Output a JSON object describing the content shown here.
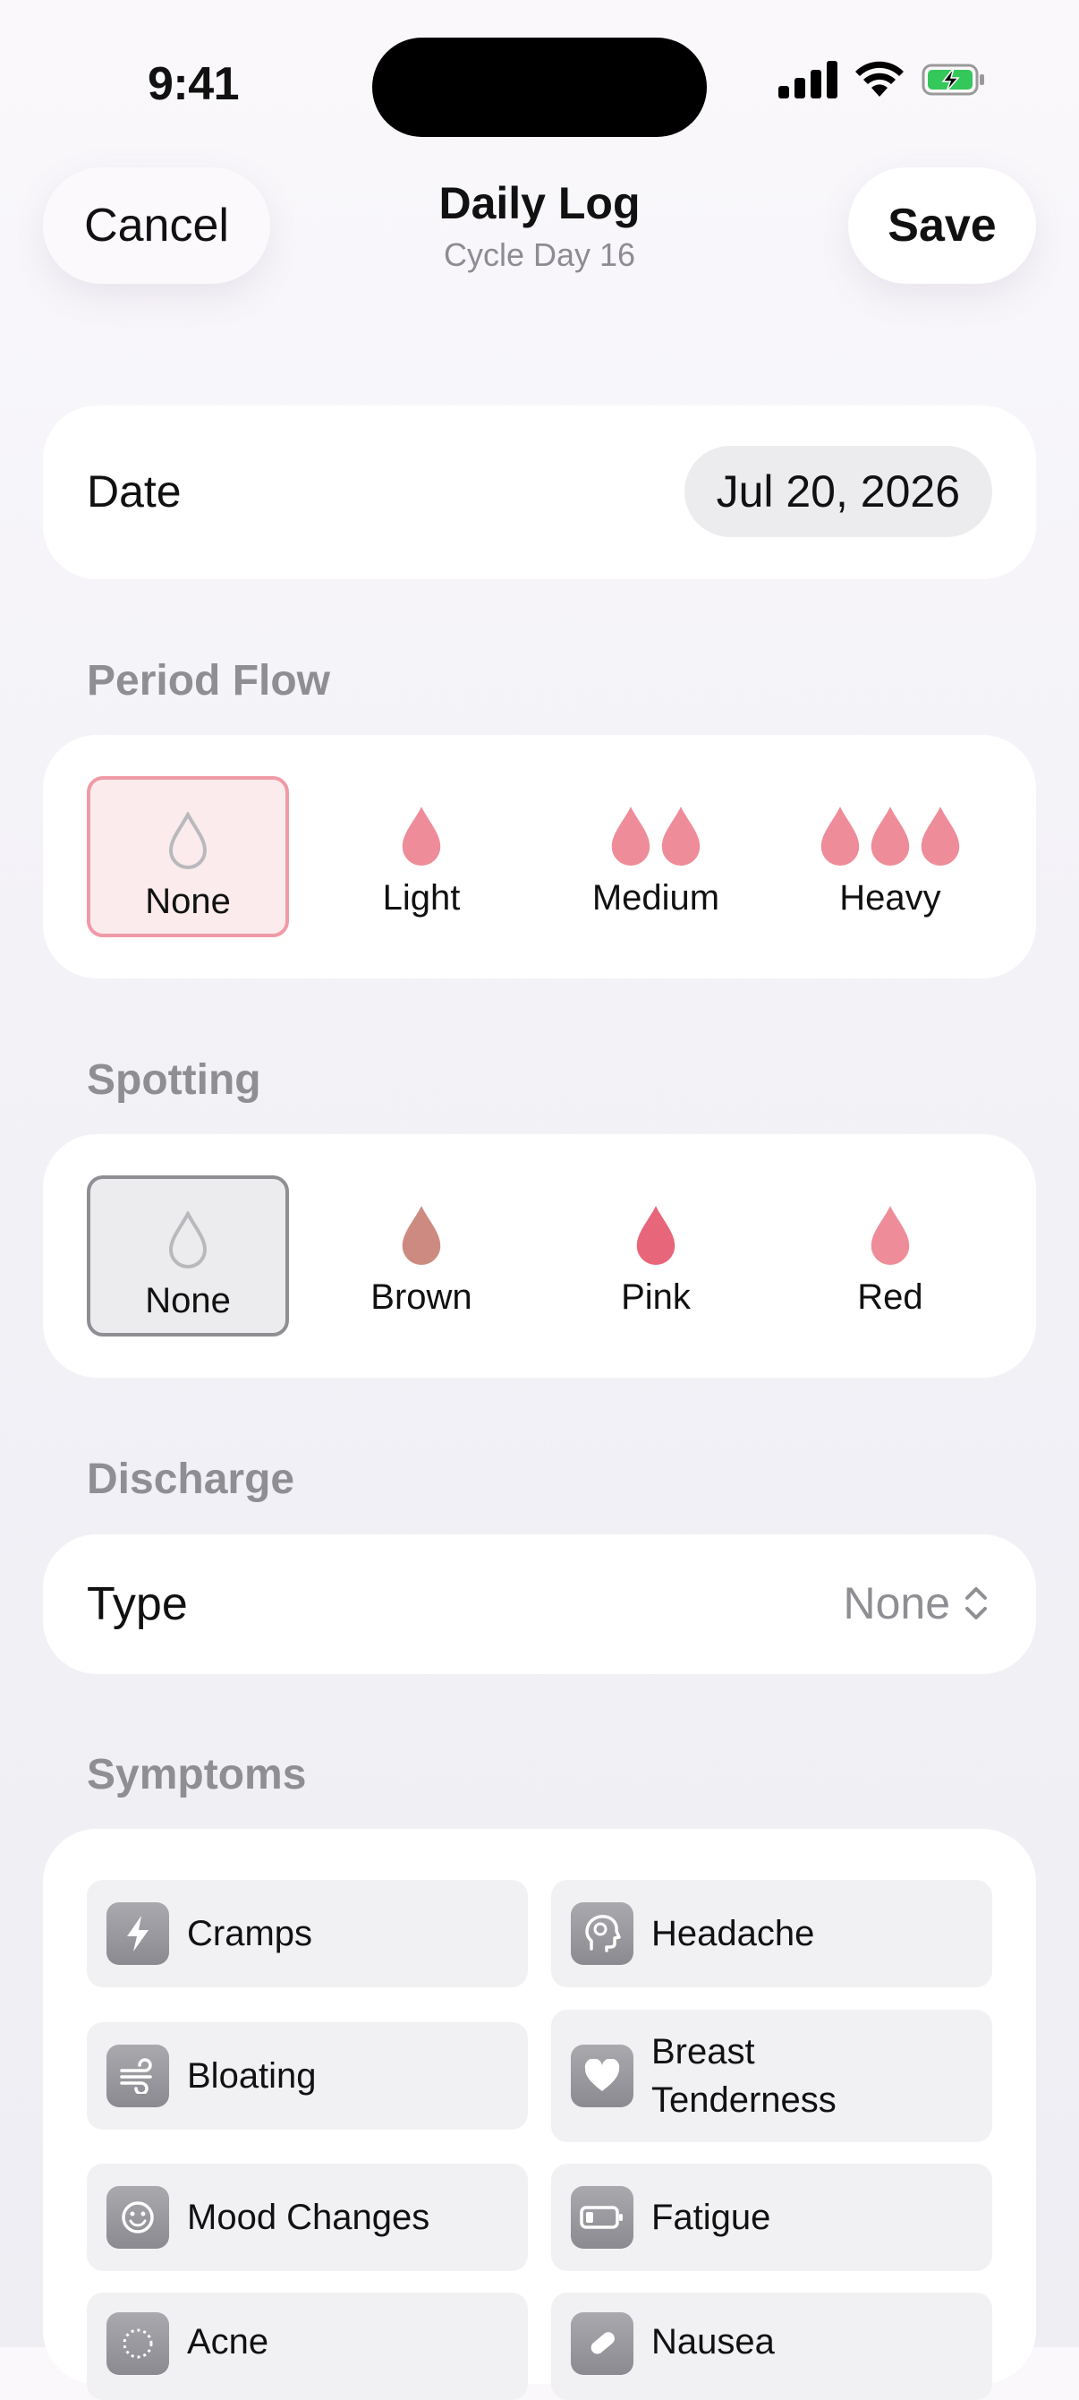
{
  "status_bar": {
    "time": "9:41"
  },
  "header": {
    "cancel_label": "Cancel",
    "title": "Daily Log",
    "subtitle": "Cycle Day 16",
    "save_label": "Save"
  },
  "date_row": {
    "label": "Date",
    "value": "Jul 20, 2026"
  },
  "period_flow": {
    "section_label": "Period Flow",
    "selected": "None",
    "options": [
      {
        "label": "None",
        "icon": "drop-outline-icon"
      },
      {
        "label": "Light",
        "icon": "drop-icon"
      },
      {
        "label": "Medium",
        "icon": "two-drops-icon"
      },
      {
        "label": "Heavy",
        "icon": "three-drops-icon"
      }
    ]
  },
  "spotting": {
    "section_label": "Spotting",
    "selected": "None",
    "options": [
      {
        "label": "None",
        "icon": "drop-outline-icon"
      },
      {
        "label": "Brown",
        "icon": "drop-icon",
        "color": "#cd8a80"
      },
      {
        "label": "Pink",
        "icon": "drop-icon",
        "color": "#e8667a"
      },
      {
        "label": "Red",
        "icon": "drop-icon",
        "color": "#ee8d99"
      }
    ]
  },
  "discharge": {
    "section_label": "Discharge",
    "type_label": "Type",
    "type_value": "None"
  },
  "symptoms": {
    "section_label": "Symptoms",
    "items": [
      {
        "label": "Cramps",
        "icon": "bolt-icon"
      },
      {
        "label": "Headache",
        "icon": "brain-head-icon"
      },
      {
        "label": "Bloating",
        "icon": "wind-icon"
      },
      {
        "label": "Breast Tenderness",
        "line1": "Breast",
        "line2": "Tenderness",
        "icon": "heart-icon"
      },
      {
        "label": "Mood Changes",
        "icon": "smiley-icon"
      },
      {
        "label": "Fatigue",
        "icon": "low-battery-icon"
      },
      {
        "label": "Acne",
        "icon": "dotted-circle-icon"
      },
      {
        "label": "Nausea",
        "icon": "pill-icon"
      }
    ]
  },
  "colors": {
    "flow_pink": "#ee8d99",
    "selected_border_pink": "#ef9aa6",
    "selected_bg_pink": "#fcebed",
    "battery_green": "#34c759"
  }
}
